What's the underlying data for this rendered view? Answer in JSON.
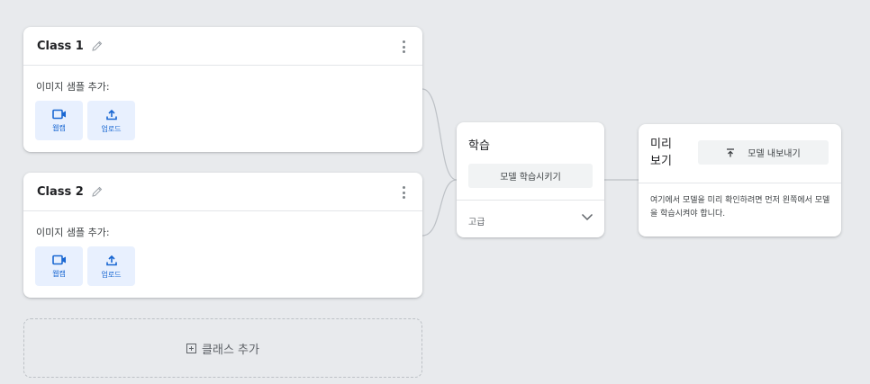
{
  "classes": [
    {
      "name": "Class 1",
      "samples_label": "이미지 샘플 추가:",
      "webcam_label": "웹캠",
      "upload_label": "업로드"
    },
    {
      "name": "Class 2",
      "samples_label": "이미지 샘플 추가:",
      "webcam_label": "웹캠",
      "upload_label": "업로드"
    }
  ],
  "add_class_label": "클래스 추가",
  "training": {
    "title": "학습",
    "train_button": "모델 학습시키기",
    "advanced_label": "고급"
  },
  "preview": {
    "title": "미리 보기",
    "export_button": "모델 내보내기",
    "message": "여기에서 모델을 미리 확인하려면 먼저 왼쪽에서 모델을 학습시켜야 합니다."
  },
  "colors": {
    "background": "#e8eaed",
    "accent": "#1967d2",
    "source_button_bg": "#e8f0fe"
  },
  "icons": [
    "pencil-icon",
    "more-vert-icon",
    "webcam-icon",
    "upload-icon",
    "add-box-icon",
    "chevron-down-icon",
    "export-icon"
  ]
}
